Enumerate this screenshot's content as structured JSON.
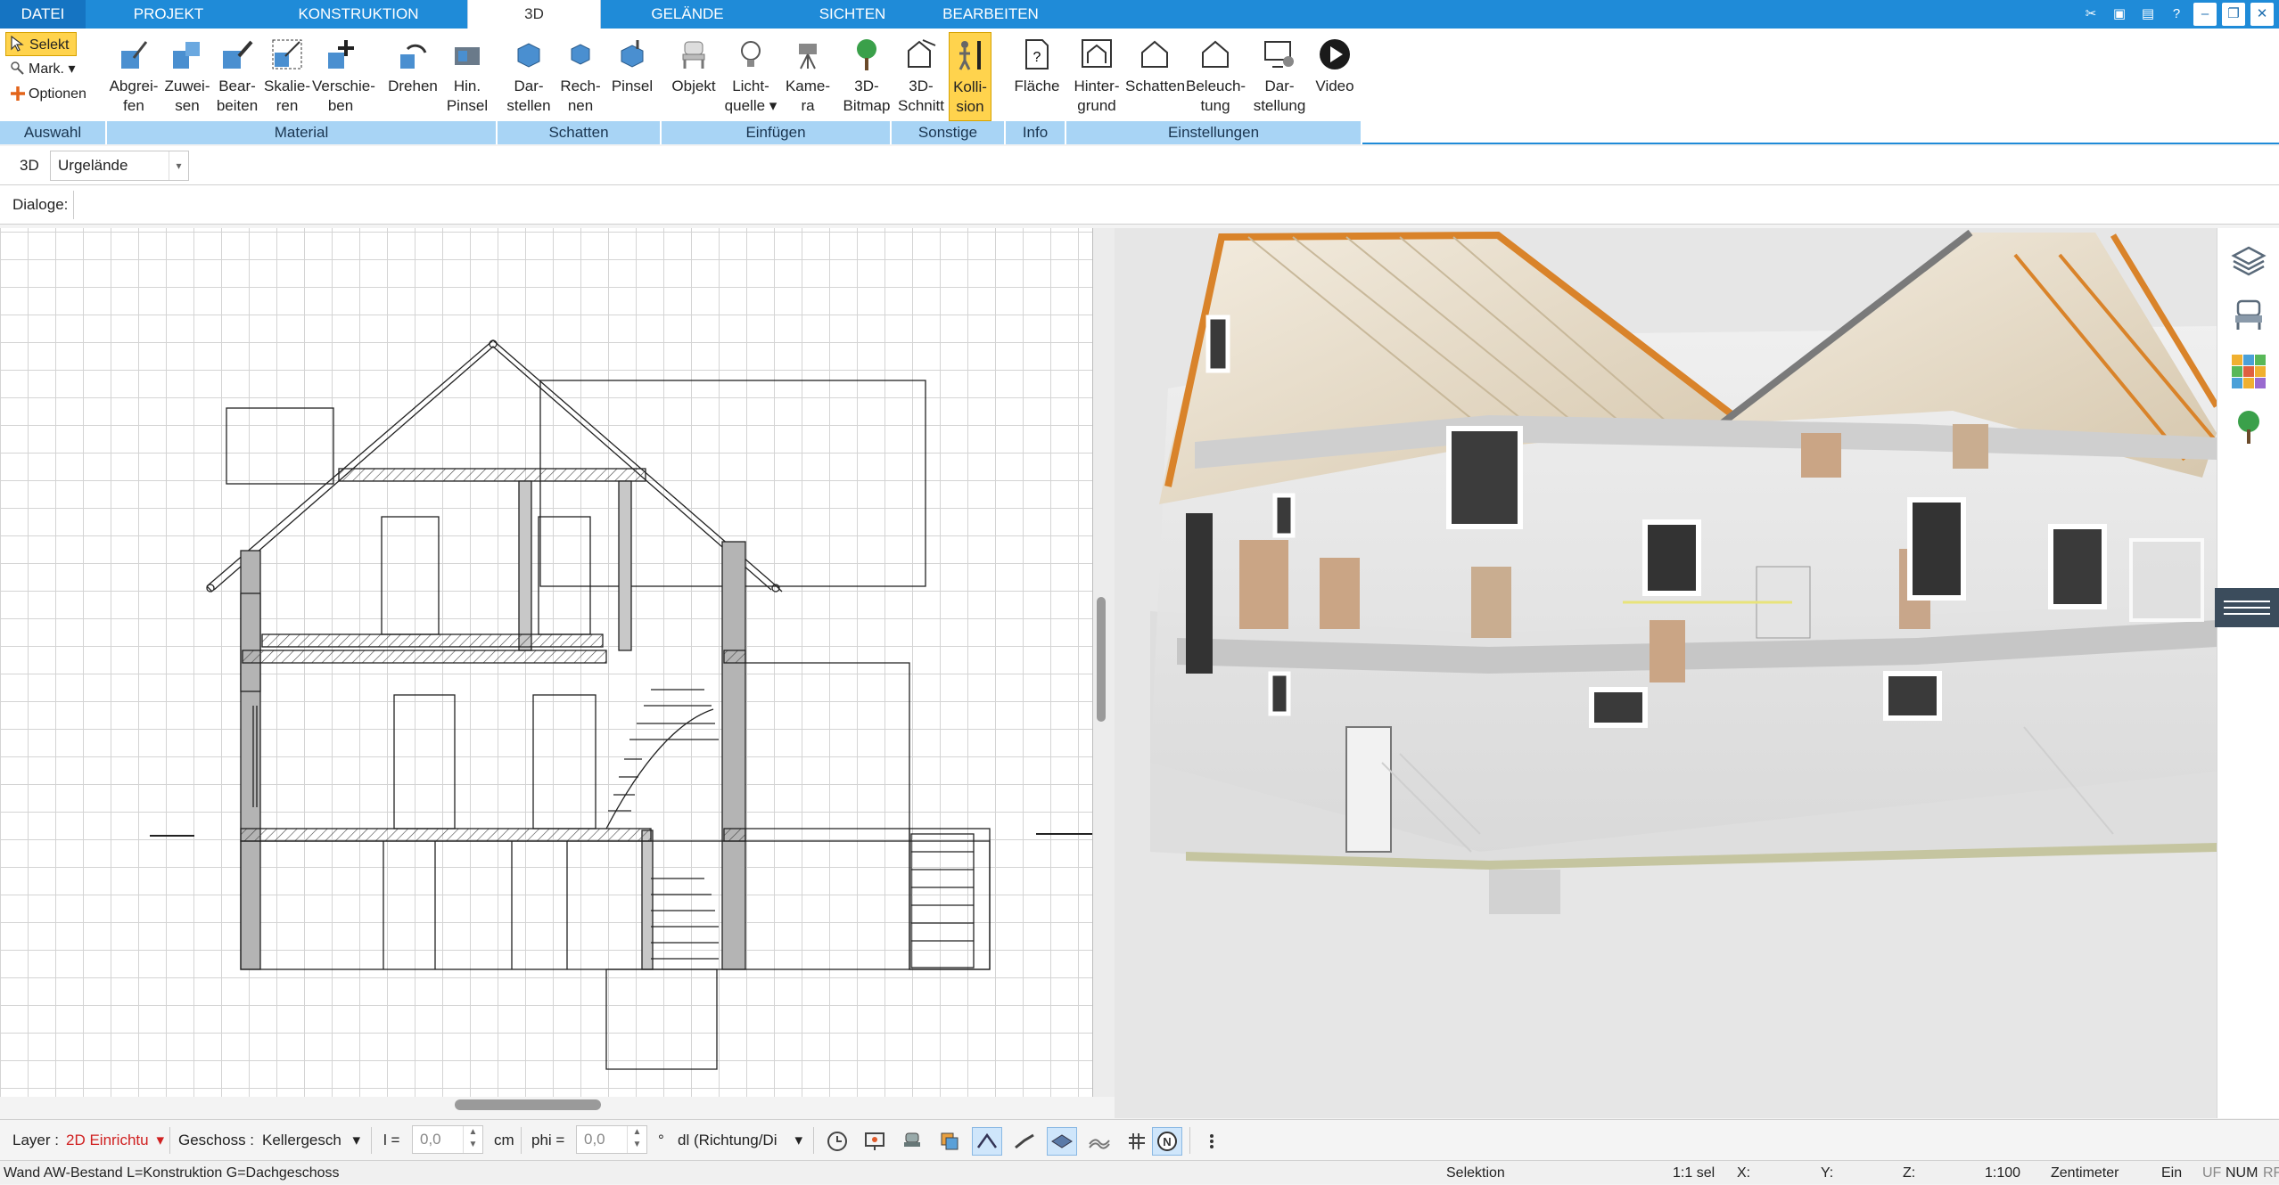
{
  "tabs": [
    {
      "label": "DATEI",
      "active": false
    },
    {
      "label": "PROJEKT",
      "active": false
    },
    {
      "label": "KONSTRUKTION",
      "active": false
    },
    {
      "label": "3D",
      "active": true
    },
    {
      "label": "GELÄNDE",
      "active": false
    },
    {
      "label": "SICHTEN",
      "active": false
    },
    {
      "label": "BEARBEITEN",
      "active": false
    }
  ],
  "window_buttons": [
    "tools-icon",
    "window-restore-icon",
    "window-tile-icon",
    "help-icon",
    "minimize-icon",
    "restore-icon",
    "close-icon"
  ],
  "ribbon": {
    "auswahl": {
      "selekt": "Selekt",
      "mark": "Mark.",
      "optionen": "Optionen"
    },
    "buttons": [
      {
        "l1": "Abgrei-",
        "l2": "fen",
        "icon": "eyedropper-icon"
      },
      {
        "l1": "Zuwei-",
        "l2": "sen",
        "icon": "assign-icon"
      },
      {
        "l1": "Bear-",
        "l2": "beiten",
        "icon": "edit-material-icon"
      },
      {
        "l1": "Skalie-",
        "l2": "ren",
        "icon": "scale-icon"
      },
      {
        "l1": "Verschie-",
        "l2": "ben",
        "icon": "move-icon"
      },
      {
        "l1": "Drehen",
        "l2": "",
        "icon": "rotate-icon"
      },
      {
        "l1": "Hin.",
        "l2": "Pinsel",
        "icon": "brush-icon"
      },
      {
        "l1": "Dar-",
        "l2": "stellen",
        "icon": "shadow-display-icon"
      },
      {
        "l1": "Rech-",
        "l2": "nen",
        "icon": "shadow-calc-icon"
      },
      {
        "l1": "Pinsel",
        "l2": "",
        "icon": "shadow-brush-icon"
      },
      {
        "l1": "Objekt",
        "l2": "",
        "icon": "chair-icon"
      },
      {
        "l1": "Licht-",
        "l2": "quelle ▾",
        "icon": "lightbulb-icon"
      },
      {
        "l1": "Kame-",
        "l2": "ra",
        "icon": "camera-icon"
      },
      {
        "l1": "3D-",
        "l2": "Bitmap",
        "icon": "tree-icon"
      },
      {
        "l1": "3D-",
        "l2": "Schnitt",
        "icon": "section-icon"
      },
      {
        "l1": "Kolli-",
        "l2": "sion",
        "icon": "collision-icon",
        "active": true
      },
      {
        "l1": "Fläche",
        "l2": "",
        "icon": "area-icon"
      },
      {
        "l1": "Hinter-",
        "l2": "grund",
        "icon": "background-icon"
      },
      {
        "l1": "Schatten",
        "l2": "",
        "icon": "house-shadow-icon"
      },
      {
        "l1": "Beleuch-",
        "l2": "tung",
        "icon": "house-light-icon"
      },
      {
        "l1": "Dar-",
        "l2": "stellung",
        "icon": "monitor-settings-icon"
      },
      {
        "l1": "Video",
        "l2": "",
        "icon": "play-icon"
      }
    ],
    "groups": [
      {
        "label": "Auswahl"
      },
      {
        "label": "Material"
      },
      {
        "label": "Schatten"
      },
      {
        "label": "Einfügen"
      },
      {
        "label": "Sonstige"
      },
      {
        "label": "Info"
      },
      {
        "label": "Einstellungen"
      }
    ]
  },
  "toolbar2": {
    "view_label": "3D",
    "terrain_value": "Urgelände"
  },
  "toolbar3": {
    "dialoge_label": "Dialoge:"
  },
  "sidepanel": [
    "layers-icon",
    "furniture-icon",
    "materials-icon",
    "plants-icon"
  ],
  "bottombar": {
    "layer_label": "Layer :",
    "layer_value": "2D Einrichtu",
    "geschoss_label": "Geschoss :",
    "geschoss_value": "Kellergesch",
    "l_label": "l =",
    "l_value": "0,0",
    "cm_label": "cm",
    "phi_label": "phi =",
    "phi_value": "0,0",
    "deg_label": "°",
    "dl_value": "dl (Richtung/Di",
    "tool_icons": [
      "clock-icon",
      "presentation-icon",
      "furniture-tool-icon",
      "copy-icon",
      "roof-tool-icon",
      "stairs-tool-icon",
      "plane-tool-icon",
      "terrain-tool-icon",
      "grid-icon",
      "north-icon",
      "more-icon"
    ]
  },
  "status": {
    "message": "Wand AW-Bestand L=Konstruktion G=Dachgeschoss",
    "mode": "Selektion",
    "selection": "1:1 sel",
    "x": "X:",
    "y": "Y:",
    "z": "Z:",
    "scale": "1:100",
    "unit": "Zentimeter",
    "ein": "Ein",
    "uf": "UF",
    "num": "NUM",
    "rf": "RF"
  },
  "colors": {
    "accent": "#1f8bd8",
    "group_bar": "#a8d4f5",
    "highlight": "#ffd34d"
  }
}
